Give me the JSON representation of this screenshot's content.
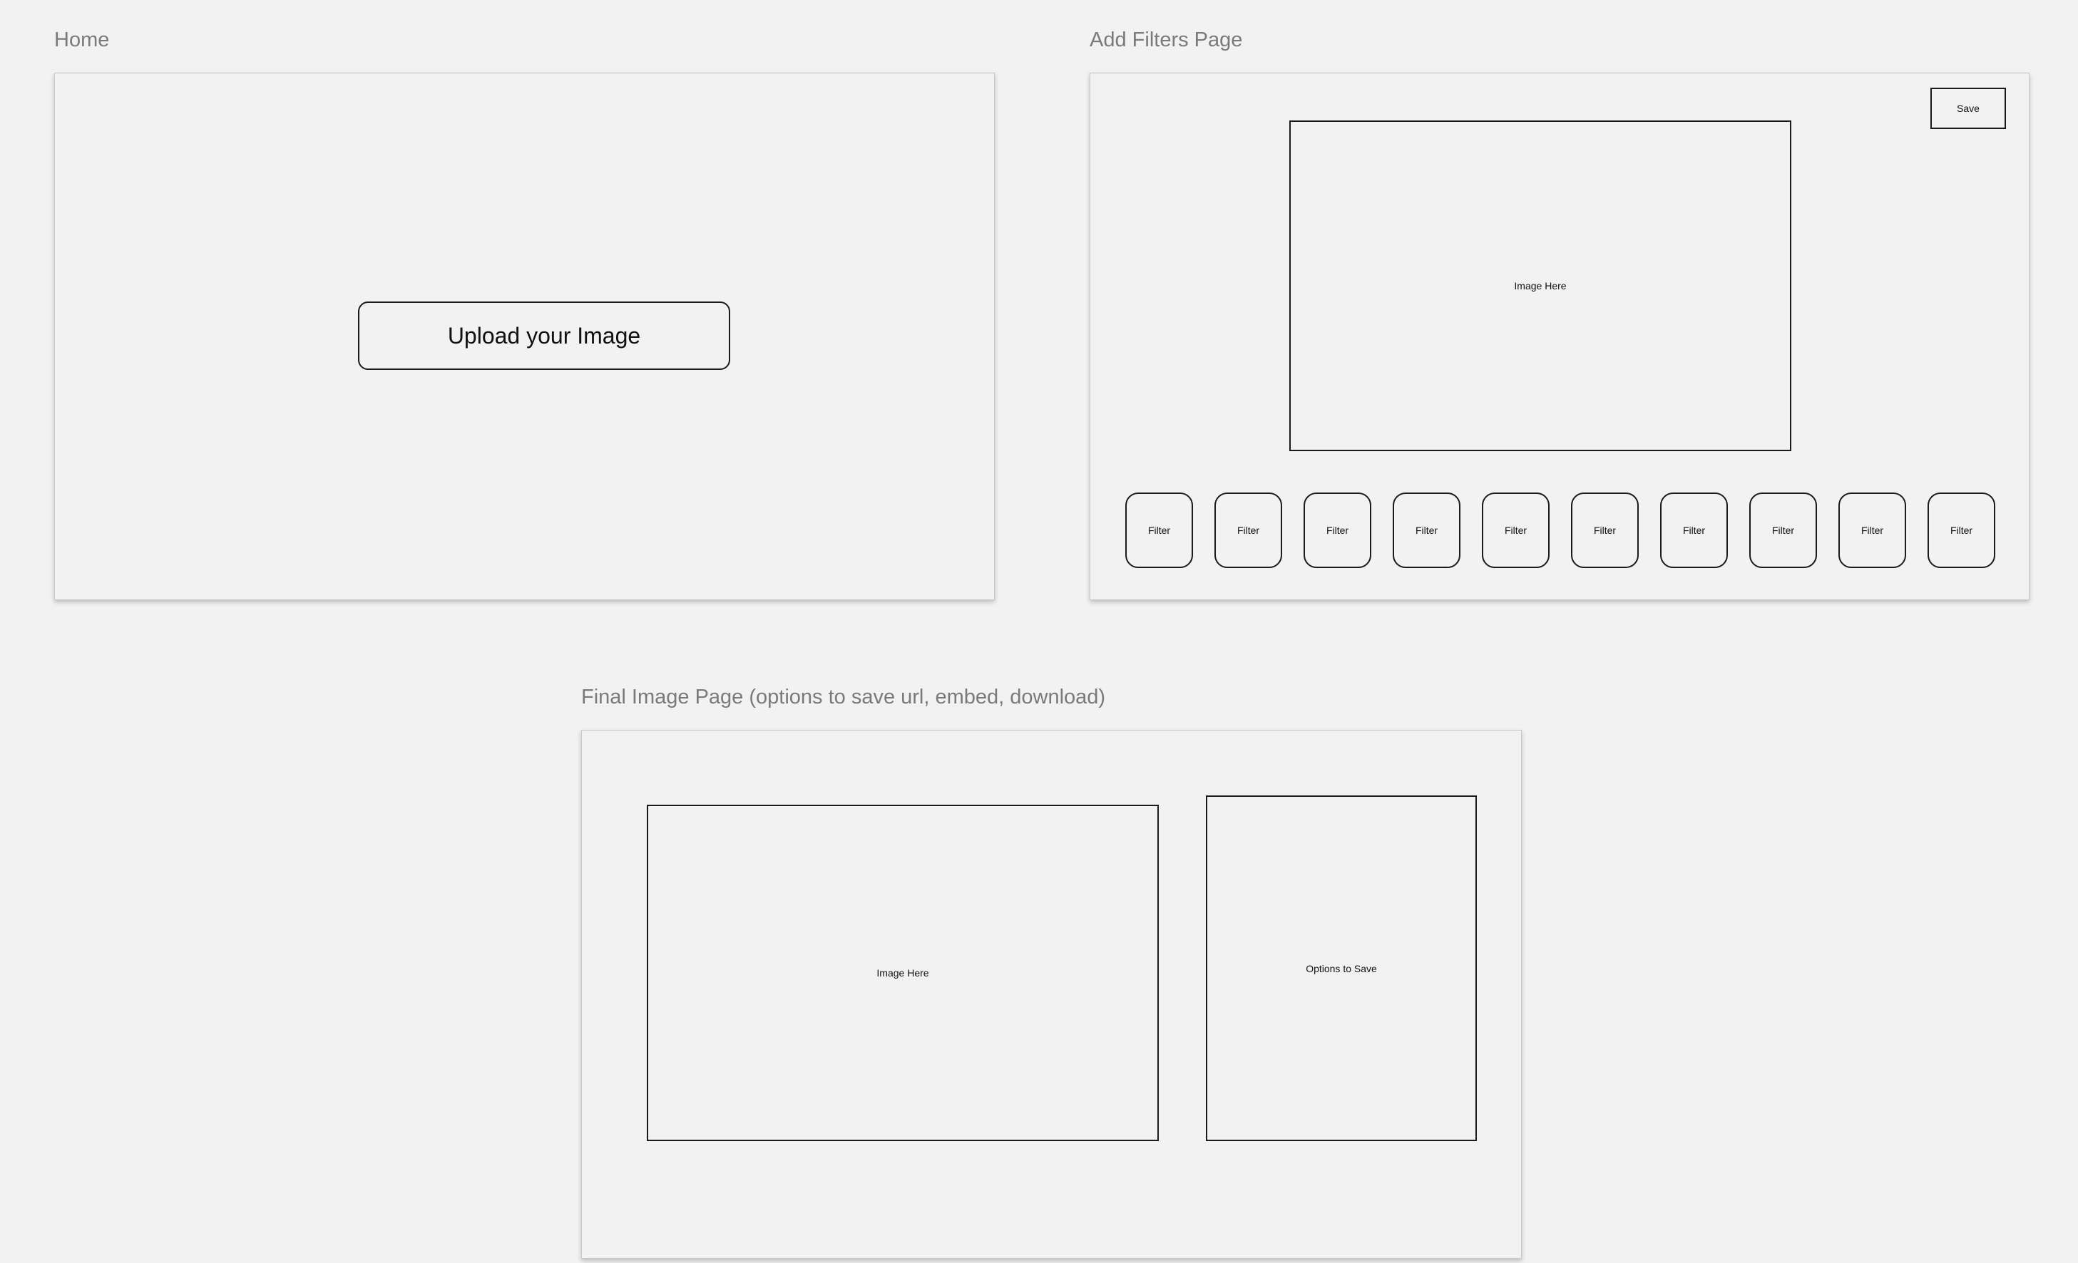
{
  "frames": {
    "home": {
      "label": "Home",
      "upload_button": "Upload your Image"
    },
    "filters": {
      "label": "Add Filters Page",
      "save_button": "Save",
      "image_placeholder": "Image Here",
      "filter_buttons": [
        "Filter",
        "Filter",
        "Filter",
        "Filter",
        "Filter",
        "Filter",
        "Filter",
        "Filter",
        "Filter",
        "Filter"
      ]
    },
    "final": {
      "label": "Final Image Page (options to save url, embed, download)",
      "image_placeholder": "Image Here",
      "options_placeholder": "Options to Save"
    }
  }
}
